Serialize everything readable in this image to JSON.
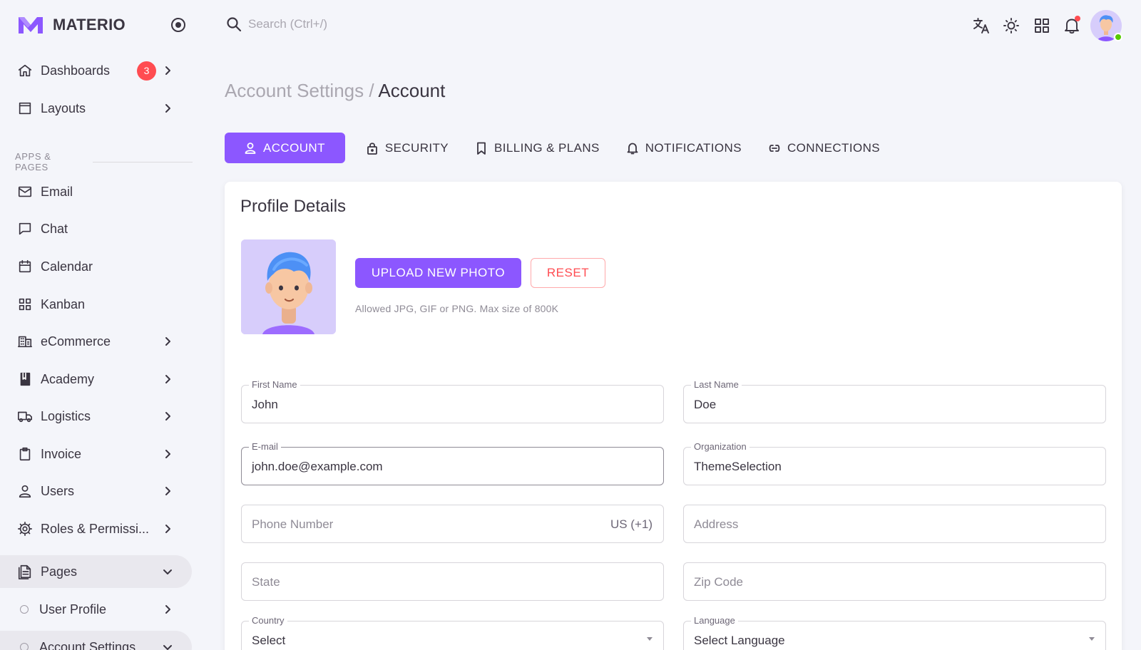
{
  "brand": {
    "name": "MATERIO",
    "color": "#8c57ff"
  },
  "sidebar": {
    "items_top": [
      {
        "label": "Dashboards",
        "badge": "3"
      },
      {
        "label": "Layouts"
      }
    ],
    "section": "APPS & PAGES",
    "items": [
      {
        "label": "Email"
      },
      {
        "label": "Chat"
      },
      {
        "label": "Calendar"
      },
      {
        "label": "Kanban"
      },
      {
        "label": "eCommerce"
      },
      {
        "label": "Academy"
      },
      {
        "label": "Logistics"
      },
      {
        "label": "Invoice"
      },
      {
        "label": "Users"
      },
      {
        "label": "Roles & Permissi..."
      },
      {
        "label": "Pages"
      },
      {
        "label": "User Profile"
      },
      {
        "label": "Account Settings"
      }
    ]
  },
  "topbar": {
    "search_placeholder": "Search (Ctrl+/)"
  },
  "breadcrumb": {
    "parent": "Account Settings",
    "separator": "/",
    "current": "Account"
  },
  "tabs": [
    {
      "label": "ACCOUNT"
    },
    {
      "label": "SECURITY"
    },
    {
      "label": "BILLING & PLANS"
    },
    {
      "label": "NOTIFICATIONS"
    },
    {
      "label": "CONNECTIONS"
    }
  ],
  "profile": {
    "title": "Profile Details",
    "upload_label": "UPLOAD NEW PHOTO",
    "reset_label": "RESET",
    "hint": "Allowed JPG, GIF or PNG. Max size of 800K"
  },
  "form": {
    "first_name": {
      "label": "First Name",
      "value": "John"
    },
    "last_name": {
      "label": "Last Name",
      "value": "Doe"
    },
    "email": {
      "label": "E-mail",
      "value": "john.doe@example.com"
    },
    "organization": {
      "label": "Organization",
      "value": "ThemeSelection"
    },
    "phone": {
      "placeholder": "Phone Number",
      "suffix": "US (+1)"
    },
    "address": {
      "placeholder": "Address"
    },
    "state": {
      "placeholder": "State"
    },
    "zip": {
      "placeholder": "Zip Code"
    },
    "country": {
      "label": "Country",
      "value": "Select"
    },
    "language": {
      "label": "Language",
      "value": "Select Language"
    }
  },
  "colors": {
    "accent": "#8c57ff",
    "danger": "#ff4c51",
    "online": "#56ca00"
  }
}
